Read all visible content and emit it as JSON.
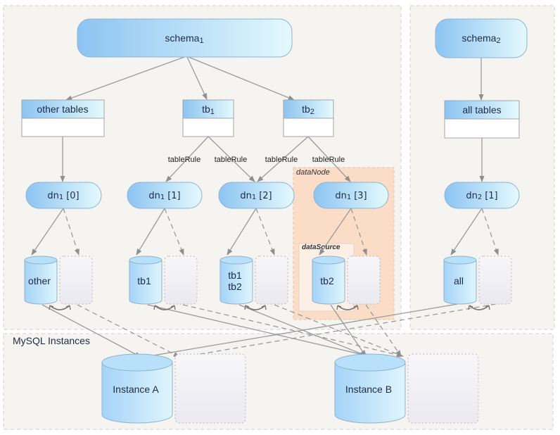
{
  "diagram": {
    "colors": {
      "panel_bg": "#f5f4f1",
      "node_light": "#e2f8fd",
      "node_dark": "#8cc4f2",
      "datanode_bg": "#fbdcc7",
      "datasource_bg": "#fcefe5",
      "edge": "#9a9a9a"
    },
    "panels": {
      "schema1_group": "",
      "schema2_group": "",
      "mysql_title": "MySQL Instances"
    },
    "schemas": [
      {
        "id": "schema1",
        "label": "schema",
        "sub": "1"
      },
      {
        "id": "schema2",
        "label": "schema",
        "sub": "2"
      }
    ],
    "tables": [
      {
        "id": "other-tables",
        "label": "other  tables",
        "sub": ""
      },
      {
        "id": "tb1",
        "label": "tb",
        "sub": "1"
      },
      {
        "id": "tb2",
        "label": "tb",
        "sub": "2"
      },
      {
        "id": "all-tables",
        "label": "all tables",
        "sub": ""
      }
    ],
    "edge_labels": [
      "tableRule",
      "tableRule",
      "tableRule",
      "tableRule"
    ],
    "datanodes": [
      {
        "id": "dn1-0",
        "prefix": "dn",
        "sub": "1",
        "index": "[0]"
      },
      {
        "id": "dn1-1",
        "prefix": "dn",
        "sub": "1",
        "index": "[1]"
      },
      {
        "id": "dn1-2",
        "prefix": "dn",
        "sub": "1",
        "index": "[2]"
      },
      {
        "id": "dn1-3",
        "prefix": "dn",
        "sub": "1",
        "index": "[3]"
      },
      {
        "id": "dn2-1",
        "prefix": "dn",
        "sub": "2",
        "index": "[1]"
      }
    ],
    "group_labels": {
      "datanode": "dataNode",
      "datasource": "dataSource"
    },
    "datasources": [
      {
        "id": "ds-other",
        "lines": [
          "other"
        ]
      },
      {
        "id": "ds-tb1",
        "lines": [
          "tb1"
        ]
      },
      {
        "id": "ds-tb1tb2",
        "lines": [
          "tb1",
          "tb2"
        ]
      },
      {
        "id": "ds-tb2",
        "lines": [
          "tb2"
        ]
      },
      {
        "id": "ds-all",
        "lines": [
          "all"
        ]
      }
    ],
    "instances": [
      {
        "id": "instance-a",
        "label": "Instance A"
      },
      {
        "id": "instance-b",
        "label": "Instance B"
      }
    ]
  }
}
